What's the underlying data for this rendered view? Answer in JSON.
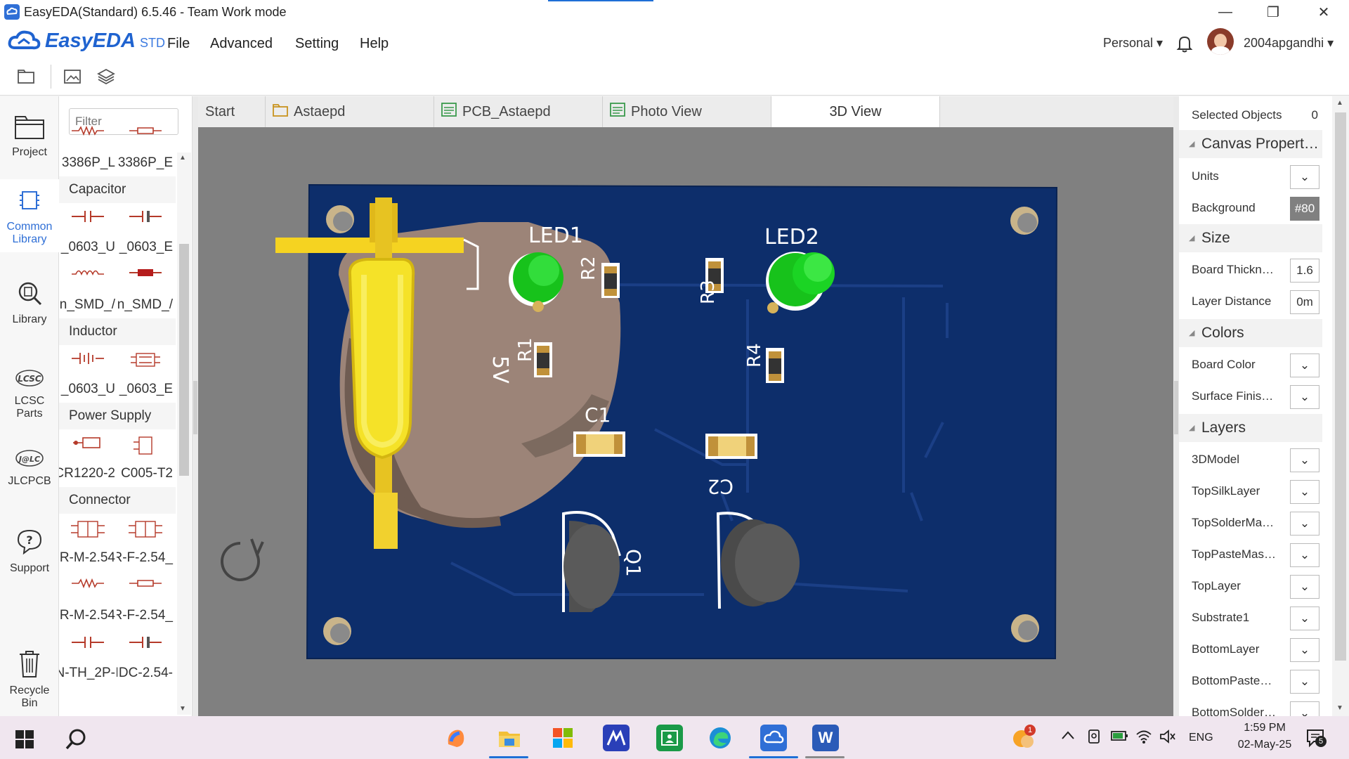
{
  "window": {
    "title": "EasyEDA(Standard) 6.5.46 - Team Work mode",
    "minimize": "—",
    "restore": "❐",
    "close": "✕"
  },
  "menubar": {
    "brand": "EasyEDA",
    "brand_suffix": "STD",
    "items": [
      "File",
      "Advanced",
      "Setting",
      "Help"
    ],
    "workspace": "Personal ▾",
    "username": "2004apgandhi ▾"
  },
  "leftnav": {
    "items": [
      {
        "label": "Project"
      },
      {
        "label": "Common Library"
      },
      {
        "label": "Library"
      },
      {
        "label": "LCSC Parts"
      },
      {
        "label": "JLCPCB"
      },
      {
        "label": "Support"
      },
      {
        "label": "Recycle Bin"
      }
    ]
  },
  "library": {
    "filter_placeholder": "Filter",
    "rows": [
      {
        "type": "pair",
        "left": "3386P_L",
        "right": "3386P_E"
      },
      {
        "type": "cat",
        "label": "Capacitor"
      },
      {
        "type": "pair",
        "left": "_0603_U",
        "right": "_0603_E"
      },
      {
        "type": "pair",
        "left": "n_SMD_/",
        "right": "n_SMD_/"
      },
      {
        "type": "cat",
        "label": "Inductor"
      },
      {
        "type": "pair",
        "left": "_0603_U",
        "right": "_0603_E"
      },
      {
        "type": "cat",
        "label": "Power Supply"
      },
      {
        "type": "pair",
        "left": "CR1220-2",
        "right": "C005-T2"
      },
      {
        "type": "cat",
        "label": "Connector"
      },
      {
        "type": "pair",
        "left": "R-M-2.54",
        "right": "R-F-2.54_"
      },
      {
        "type": "pair",
        "left": "R-M-2.54",
        "right": "R-F-2.54_"
      },
      {
        "type": "pair",
        "left": "N-TH_2P-",
        "right": "IDC-2.54-"
      }
    ]
  },
  "tabs": [
    {
      "label": "Start"
    },
    {
      "label": "Astaepd"
    },
    {
      "label": "PCB_Astaepd"
    },
    {
      "label": "Photo View"
    },
    {
      "label": "3D View"
    }
  ],
  "pcb": {
    "board_color": "#0d2e6b",
    "labels": {
      "led1": "LED1",
      "led2": "LED2",
      "r1": "R1",
      "r2": "R2",
      "r3": "R3",
      "r4": "R4",
      "c1": "C1",
      "c2": "C2",
      "q1": "Q1",
      "v5": "5V"
    }
  },
  "rightpanel": {
    "selected_label": "Selected Objects",
    "selected_count": "0",
    "sections": {
      "canvas": "Canvas Propert…",
      "size": "Size",
      "colors": "Colors",
      "layers": "Layers"
    },
    "canvas_rows": [
      {
        "label": "Units",
        "value": "⌄"
      },
      {
        "label": "Background",
        "value": "#80"
      }
    ],
    "size_rows": [
      {
        "label": "Board Thickn…",
        "value": "1.6"
      },
      {
        "label": "Layer Distance",
        "value": "0m"
      }
    ],
    "color_rows": [
      {
        "label": "Board Color",
        "value": "⌄"
      },
      {
        "label": "Surface Finis…",
        "value": "⌄"
      }
    ],
    "layer_rows": [
      {
        "label": "3DModel",
        "value": "⌄"
      },
      {
        "label": "TopSilkLayer",
        "value": "⌄"
      },
      {
        "label": "TopSolderMa…",
        "value": "⌄"
      },
      {
        "label": "TopPasteMas…",
        "value": "⌄"
      },
      {
        "label": "TopLayer",
        "value": "⌄"
      },
      {
        "label": "Substrate1",
        "value": "⌄"
      },
      {
        "label": "BottomLayer",
        "value": "⌄"
      },
      {
        "label": "BottomPaste…",
        "value": "⌄"
      },
      {
        "label": "BottomSolder…",
        "value": "⌄"
      }
    ]
  },
  "taskbar": {
    "language": "ENG",
    "time": "1:59 PM",
    "date": "02-May-25",
    "notification_count": "5",
    "weather_badge": "1"
  }
}
